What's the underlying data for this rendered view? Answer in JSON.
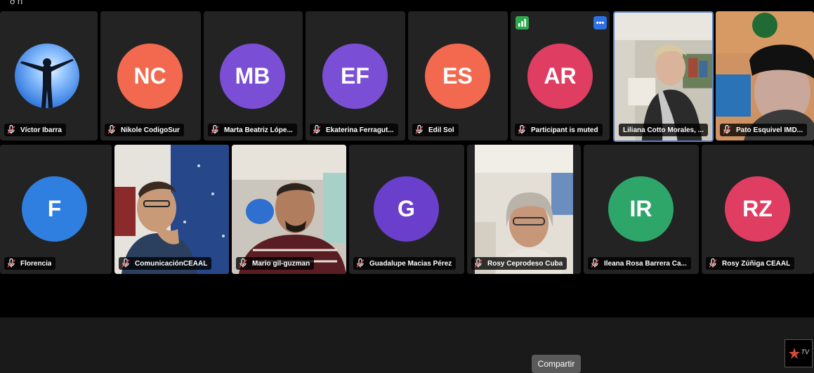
{
  "top_bar": {
    "glyph": "ð ñ"
  },
  "participants_row1": [
    {
      "name": "Víctor Ibarra",
      "type": "photo",
      "muted": true
    },
    {
      "name": "Nikole CodigoSur",
      "initials": "NC",
      "color": "#f2694f",
      "muted": true
    },
    {
      "name": "Marta Beatriz Lópe...",
      "initials": "MB",
      "color": "#7a4fd6",
      "muted": true
    },
    {
      "name": "Ekaterina Ferragut...",
      "initials": "EF",
      "color": "#7a4fd6",
      "muted": true
    },
    {
      "name": "Edil Sol",
      "initials": "ES",
      "color": "#f2694f",
      "muted": true
    },
    {
      "name": "Participant is muted",
      "initials": "AR",
      "color": "#e03d62",
      "muted": true
    },
    {
      "name": "Liliana Cotto Morales, ...",
      "type": "video",
      "muted": false,
      "active_speaker": true
    },
    {
      "name": "Pato Esquivel IMD...",
      "type": "video",
      "muted": true
    }
  ],
  "participants_row2": [
    {
      "name": "Florencia",
      "initials": "F",
      "color": "#2f7fe0",
      "muted": true
    },
    {
      "name": "ComunicaciónCEAAL",
      "type": "video",
      "muted": true
    },
    {
      "name": "Mario gil-guzman",
      "type": "video",
      "muted": true
    },
    {
      "name": "Guadalupe Macias Pérez",
      "initials": "G",
      "color": "#6a3fcc",
      "muted": true
    },
    {
      "name": "Rosy Ceprodeso Cuba",
      "type": "video",
      "muted": true
    },
    {
      "name": "Ileana Rosa Barrera Ca...",
      "initials": "IR",
      "color": "#2ea66a",
      "muted": true
    },
    {
      "name": "Rosy Zúñiga CEAAL",
      "initials": "RZ",
      "color": "#e03d62",
      "muted": true
    }
  ],
  "badges": {
    "blue_label": "•••"
  },
  "share_button": {
    "label": "Compartir"
  },
  "logo": {
    "tv_label": "TV"
  }
}
